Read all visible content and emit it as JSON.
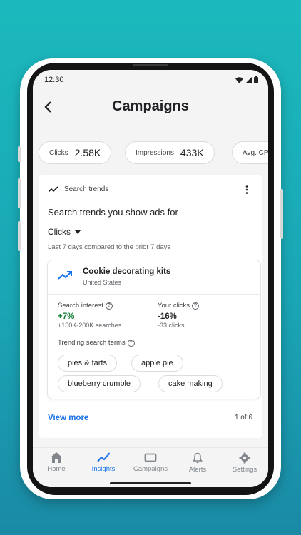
{
  "status_bar": {
    "time": "12:30"
  },
  "header": {
    "title": "Campaigns"
  },
  "metrics": [
    {
      "label": "Clicks",
      "value": "2.58K"
    },
    {
      "label": "Impressions",
      "value": "433K"
    },
    {
      "label": "Avg. CP",
      "value": ""
    }
  ],
  "section": {
    "label": "Search trends",
    "title": "Search trends you show ads for",
    "dropdown": "Clicks",
    "comparison": "Last 7 days compared to the prior 7 days"
  },
  "trend_card": {
    "title": "Cookie decorating kits",
    "location": "United States",
    "search_interest": {
      "label": "Search interest",
      "value": "+7%",
      "sub": "+150K-200K searches",
      "color": "#188038"
    },
    "your_clicks": {
      "label": "Your clicks",
      "value": "-16%",
      "sub": "-33 clicks",
      "color": "#202124"
    },
    "trending_label": "Trending search terms",
    "terms": [
      "pies & tarts",
      "apple pie",
      "blueberry crumble",
      "cake making"
    ]
  },
  "footer": {
    "view_more": "View more",
    "pager": "1 of 6"
  },
  "nav": {
    "items": [
      {
        "label": "Home",
        "icon": "home-icon"
      },
      {
        "label": "Insights",
        "icon": "insights-icon"
      },
      {
        "label": "Campaigns",
        "icon": "campaigns-icon"
      },
      {
        "label": "Alerts",
        "icon": "bell-icon"
      },
      {
        "label": "Settings",
        "icon": "gear-icon"
      }
    ],
    "active": "Insights"
  },
  "colors": {
    "accent": "#1a73e8",
    "positive": "#188038",
    "background_top": "#1bb9bd",
    "background_bottom": "#1a8aa5"
  }
}
